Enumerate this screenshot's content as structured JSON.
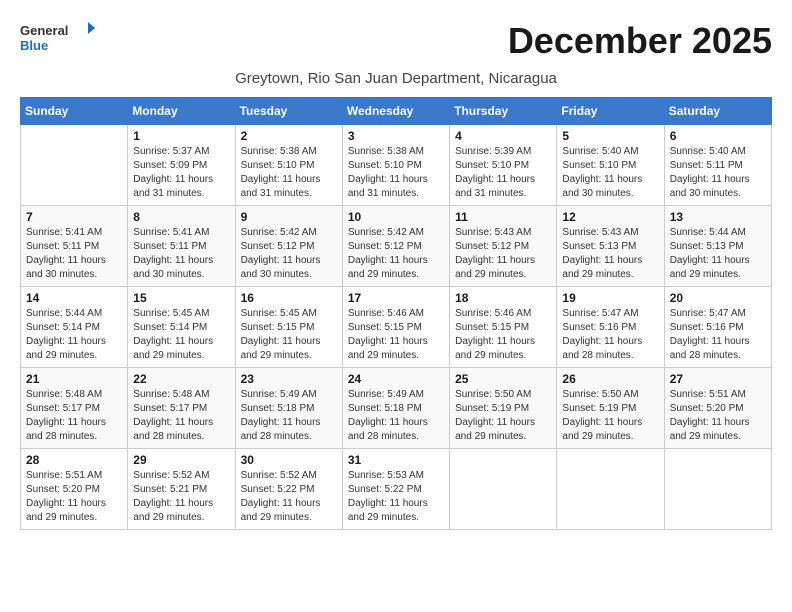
{
  "header": {
    "logo_line1": "General",
    "logo_line2": "Blue",
    "month_year": "December 2025",
    "location": "Greytown, Rio San Juan Department, Nicaragua"
  },
  "weekdays": [
    "Sunday",
    "Monday",
    "Tuesday",
    "Wednesday",
    "Thursday",
    "Friday",
    "Saturday"
  ],
  "weeks": [
    [
      {
        "day": "",
        "sunrise": "",
        "sunset": "",
        "daylight": ""
      },
      {
        "day": "1",
        "sunrise": "Sunrise: 5:37 AM",
        "sunset": "Sunset: 5:09 PM",
        "daylight": "Daylight: 11 hours and 31 minutes."
      },
      {
        "day": "2",
        "sunrise": "Sunrise: 5:38 AM",
        "sunset": "Sunset: 5:10 PM",
        "daylight": "Daylight: 11 hours and 31 minutes."
      },
      {
        "day": "3",
        "sunrise": "Sunrise: 5:38 AM",
        "sunset": "Sunset: 5:10 PM",
        "daylight": "Daylight: 11 hours and 31 minutes."
      },
      {
        "day": "4",
        "sunrise": "Sunrise: 5:39 AM",
        "sunset": "Sunset: 5:10 PM",
        "daylight": "Daylight: 11 hours and 31 minutes."
      },
      {
        "day": "5",
        "sunrise": "Sunrise: 5:40 AM",
        "sunset": "Sunset: 5:10 PM",
        "daylight": "Daylight: 11 hours and 30 minutes."
      },
      {
        "day": "6",
        "sunrise": "Sunrise: 5:40 AM",
        "sunset": "Sunset: 5:11 PM",
        "daylight": "Daylight: 11 hours and 30 minutes."
      }
    ],
    [
      {
        "day": "7",
        "sunrise": "Sunrise: 5:41 AM",
        "sunset": "Sunset: 5:11 PM",
        "daylight": "Daylight: 11 hours and 30 minutes."
      },
      {
        "day": "8",
        "sunrise": "Sunrise: 5:41 AM",
        "sunset": "Sunset: 5:11 PM",
        "daylight": "Daylight: 11 hours and 30 minutes."
      },
      {
        "day": "9",
        "sunrise": "Sunrise: 5:42 AM",
        "sunset": "Sunset: 5:12 PM",
        "daylight": "Daylight: 11 hours and 30 minutes."
      },
      {
        "day": "10",
        "sunrise": "Sunrise: 5:42 AM",
        "sunset": "Sunset: 5:12 PM",
        "daylight": "Daylight: 11 hours and 29 minutes."
      },
      {
        "day": "11",
        "sunrise": "Sunrise: 5:43 AM",
        "sunset": "Sunset: 5:12 PM",
        "daylight": "Daylight: 11 hours and 29 minutes."
      },
      {
        "day": "12",
        "sunrise": "Sunrise: 5:43 AM",
        "sunset": "Sunset: 5:13 PM",
        "daylight": "Daylight: 11 hours and 29 minutes."
      },
      {
        "day": "13",
        "sunrise": "Sunrise: 5:44 AM",
        "sunset": "Sunset: 5:13 PM",
        "daylight": "Daylight: 11 hours and 29 minutes."
      }
    ],
    [
      {
        "day": "14",
        "sunrise": "Sunrise: 5:44 AM",
        "sunset": "Sunset: 5:14 PM",
        "daylight": "Daylight: 11 hours and 29 minutes."
      },
      {
        "day": "15",
        "sunrise": "Sunrise: 5:45 AM",
        "sunset": "Sunset: 5:14 PM",
        "daylight": "Daylight: 11 hours and 29 minutes."
      },
      {
        "day": "16",
        "sunrise": "Sunrise: 5:45 AM",
        "sunset": "Sunset: 5:15 PM",
        "daylight": "Daylight: 11 hours and 29 minutes."
      },
      {
        "day": "17",
        "sunrise": "Sunrise: 5:46 AM",
        "sunset": "Sunset: 5:15 PM",
        "daylight": "Daylight: 11 hours and 29 minutes."
      },
      {
        "day": "18",
        "sunrise": "Sunrise: 5:46 AM",
        "sunset": "Sunset: 5:15 PM",
        "daylight": "Daylight: 11 hours and 29 minutes."
      },
      {
        "day": "19",
        "sunrise": "Sunrise: 5:47 AM",
        "sunset": "Sunset: 5:16 PM",
        "daylight": "Daylight: 11 hours and 28 minutes."
      },
      {
        "day": "20",
        "sunrise": "Sunrise: 5:47 AM",
        "sunset": "Sunset: 5:16 PM",
        "daylight": "Daylight: 11 hours and 28 minutes."
      }
    ],
    [
      {
        "day": "21",
        "sunrise": "Sunrise: 5:48 AM",
        "sunset": "Sunset: 5:17 PM",
        "daylight": "Daylight: 11 hours and 28 minutes."
      },
      {
        "day": "22",
        "sunrise": "Sunrise: 5:48 AM",
        "sunset": "Sunset: 5:17 PM",
        "daylight": "Daylight: 11 hours and 28 minutes."
      },
      {
        "day": "23",
        "sunrise": "Sunrise: 5:49 AM",
        "sunset": "Sunset: 5:18 PM",
        "daylight": "Daylight: 11 hours and 28 minutes."
      },
      {
        "day": "24",
        "sunrise": "Sunrise: 5:49 AM",
        "sunset": "Sunset: 5:18 PM",
        "daylight": "Daylight: 11 hours and 28 minutes."
      },
      {
        "day": "25",
        "sunrise": "Sunrise: 5:50 AM",
        "sunset": "Sunset: 5:19 PM",
        "daylight": "Daylight: 11 hours and 29 minutes."
      },
      {
        "day": "26",
        "sunrise": "Sunrise: 5:50 AM",
        "sunset": "Sunset: 5:19 PM",
        "daylight": "Daylight: 11 hours and 29 minutes."
      },
      {
        "day": "27",
        "sunrise": "Sunrise: 5:51 AM",
        "sunset": "Sunset: 5:20 PM",
        "daylight": "Daylight: 11 hours and 29 minutes."
      }
    ],
    [
      {
        "day": "28",
        "sunrise": "Sunrise: 5:51 AM",
        "sunset": "Sunset: 5:20 PM",
        "daylight": "Daylight: 11 hours and 29 minutes."
      },
      {
        "day": "29",
        "sunrise": "Sunrise: 5:52 AM",
        "sunset": "Sunset: 5:21 PM",
        "daylight": "Daylight: 11 hours and 29 minutes."
      },
      {
        "day": "30",
        "sunrise": "Sunrise: 5:52 AM",
        "sunset": "Sunset: 5:22 PM",
        "daylight": "Daylight: 11 hours and 29 minutes."
      },
      {
        "day": "31",
        "sunrise": "Sunrise: 5:53 AM",
        "sunset": "Sunset: 5:22 PM",
        "daylight": "Daylight: 11 hours and 29 minutes."
      },
      {
        "day": "",
        "sunrise": "",
        "sunset": "",
        "daylight": ""
      },
      {
        "day": "",
        "sunrise": "",
        "sunset": "",
        "daylight": ""
      },
      {
        "day": "",
        "sunrise": "",
        "sunset": "",
        "daylight": ""
      }
    ]
  ]
}
